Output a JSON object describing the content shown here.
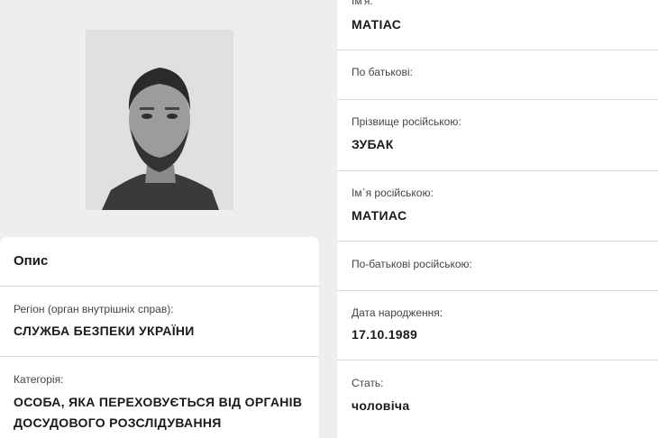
{
  "left": {
    "heading": "Опис",
    "region_label": "Регіон (орган внутрішніх справ):",
    "region_value": "СЛУЖБА БЕЗПЕКИ УКРАЇНИ",
    "category_label": "Категорія:",
    "category_value_line1": "ОСОБА, ЯКА ПЕРЕХОВУЄТЬСЯ ВІД ОРГАНІВ",
    "category_value_line2": "ДОСУДОВОГО РОЗСЛІДУВАННЯ"
  },
  "right": {
    "name_label": "Ім'я:",
    "name_value": "МАТІАС",
    "patronymic_label": "По батькові:",
    "surname_ru_label": "Прізвище російською:",
    "surname_ru_value": "ЗУБАК",
    "name_ru_label": "Ім`я російською:",
    "name_ru_value": "МАТИАС",
    "patronymic_ru_label": "По-батькові російською:",
    "dob_label": "Дата народження:",
    "dob_value": "17.10.1989",
    "sex_label": "Стать:",
    "sex_value": "чоловіча"
  }
}
